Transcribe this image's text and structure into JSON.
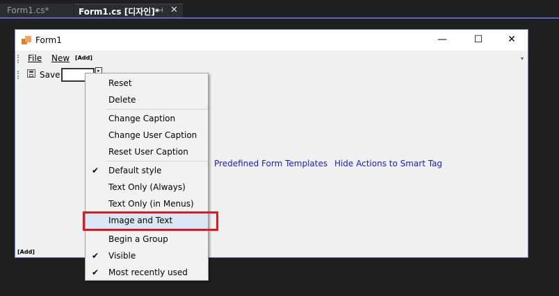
{
  "tabs": {
    "inactive_label": "Form1.cs*",
    "active_label": "Form1.cs [디자인]*",
    "pin_glyph": "⊣",
    "close_glyph": "✕"
  },
  "form": {
    "title": "Form1",
    "minimize_glyph": "—",
    "maximize_glyph": "☐",
    "close_glyph": "✕"
  },
  "menubar": {
    "file_label": "File",
    "new_label": "New",
    "add_label": "[Add]",
    "dropdown_glyph": "▾"
  },
  "toolbar": {
    "save_label": "Save",
    "dropbtn_glyph": "▸"
  },
  "smart_links": {
    "predefined": "Predefined Form Templates",
    "hide_actions": "Hide Actions to Smart Tag"
  },
  "bottom_add_label": "[Add]",
  "context_menu": {
    "items": [
      {
        "label": "Reset",
        "checked": false
      },
      {
        "label": "Delete",
        "checked": false
      },
      {
        "label": "Change Caption",
        "checked": false
      },
      {
        "label": "Change User Caption",
        "checked": false
      },
      {
        "label": "Reset User Caption",
        "checked": false
      },
      {
        "label": "Default style",
        "checked": true
      },
      {
        "label": "Text Only (Always)",
        "checked": false
      },
      {
        "label": "Text Only (in Menus)",
        "checked": false
      },
      {
        "label": "Image and Text",
        "checked": false
      },
      {
        "label": "Begin a Group",
        "checked": false
      },
      {
        "label": "Visible",
        "checked": true
      },
      {
        "label": "Most recently used",
        "checked": true
      }
    ],
    "check_glyph": "✔"
  },
  "colors": {
    "accent": "#6b5fd0",
    "link": "#1a1ac8",
    "highlight_border": "#e3161f",
    "hover_bg": "#dae6f5"
  }
}
